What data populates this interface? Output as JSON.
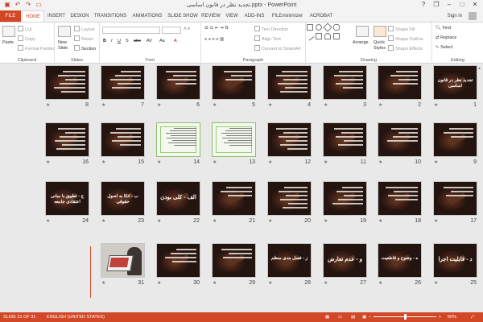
{
  "window": {
    "title": "تجدید نظر در قانون اساسی.pptx - PowerPoint"
  },
  "qat": {
    "save_icon": "save-icon",
    "undo_icon": "undo-icon",
    "redo_icon": "redo-icon",
    "present_icon": "present-icon"
  },
  "window_controls": {
    "help": "?",
    "restore": "❐",
    "minimize": "–",
    "maximize": "□",
    "close": "✕"
  },
  "tabs": [
    {
      "label": "FILE"
    },
    {
      "label": "HOME"
    },
    {
      "label": "INSERT"
    },
    {
      "label": "DESIGN"
    },
    {
      "label": "TRANSITIONS"
    },
    {
      "label": "ANIMATIONS"
    },
    {
      "label": "SLIDE SHOW"
    },
    {
      "label": "REVIEW"
    },
    {
      "label": "VIEW"
    },
    {
      "label": "ADD-INS"
    },
    {
      "label": "FILEminimizer"
    },
    {
      "label": "ACROBAT"
    }
  ],
  "account": {
    "signin": "Sign in"
  },
  "ribbon": {
    "clipboard": {
      "label": "Clipboard",
      "paste": "Paste",
      "cut": "Cut",
      "copy": "Copy",
      "format_painter": "Format Painter"
    },
    "slides": {
      "label": "Slides",
      "new_slide": "New",
      "new_slide2": "Slide",
      "layout": "Layout",
      "reset": "Reset",
      "section": "Section"
    },
    "font": {
      "label": "Font"
    },
    "paragraph": {
      "label": "Paragraph",
      "text_direction": "Text Direction",
      "align_text": "Align Text",
      "convert": "Convert to SmartArt"
    },
    "drawing": {
      "label": "Drawing",
      "arrange": "Arrange",
      "quick_styles": "Quick",
      "quick_styles2": "Styles",
      "shape_fill": "Shape Fill",
      "shape_outline": "Shape Outline",
      "shape_effects": "Shape Effects"
    },
    "editing": {
      "label": "Editing",
      "find": "Find",
      "replace": "Replace",
      "select": "Select"
    }
  },
  "slides": [
    {
      "num": "1",
      "title": "تجدید نظر در قانون اساسی",
      "kind": "title"
    },
    {
      "num": "2",
      "title": "",
      "kind": "text"
    },
    {
      "num": "3",
      "title": "",
      "kind": "text"
    },
    {
      "num": "4",
      "title": "",
      "kind": "text"
    },
    {
      "num": "5",
      "title": "",
      "kind": "text"
    },
    {
      "num": "6",
      "title": "",
      "kind": "text"
    },
    {
      "num": "7",
      "title": "",
      "kind": "text"
    },
    {
      "num": "8",
      "title": "",
      "kind": "text"
    },
    {
      "num": "9",
      "title": "",
      "kind": "text"
    },
    {
      "num": "10",
      "title": "",
      "kind": "text"
    },
    {
      "num": "11",
      "title": "",
      "kind": "text"
    },
    {
      "num": "12",
      "title": "",
      "kind": "text"
    },
    {
      "num": "13",
      "title": "",
      "kind": "doc"
    },
    {
      "num": "14",
      "title": "",
      "kind": "doc"
    },
    {
      "num": "15",
      "title": "",
      "kind": "text"
    },
    {
      "num": "16",
      "title": "",
      "kind": "text"
    },
    {
      "num": "17",
      "title": "",
      "kind": "text"
    },
    {
      "num": "18",
      "title": "",
      "kind": "text"
    },
    {
      "num": "19",
      "title": "",
      "kind": "text"
    },
    {
      "num": "20",
      "title": "",
      "kind": "text"
    },
    {
      "num": "21",
      "title": "",
      "kind": "text"
    },
    {
      "num": "22",
      "title": "الف - کلی بودن",
      "kind": "title"
    },
    {
      "num": "23",
      "title": "ب - اتکا به اصول حقوقی",
      "kind": "title"
    },
    {
      "num": "24",
      "title": "ج - تطبیق با مبانی اعتقادی جامعه",
      "kind": "title"
    },
    {
      "num": "25",
      "title": "د - قابلیت اجرا",
      "kind": "title"
    },
    {
      "num": "26",
      "title": "ه - وضوح و قاطعیت",
      "kind": "title"
    },
    {
      "num": "27",
      "title": "و - عدم تعارض",
      "kind": "title"
    },
    {
      "num": "28",
      "title": "ز - فصل بندی منظم",
      "kind": "title"
    },
    {
      "num": "29",
      "title": "",
      "kind": "text"
    },
    {
      "num": "30",
      "title": "",
      "kind": "text"
    },
    {
      "num": "31",
      "title": "",
      "kind": "photo"
    }
  ],
  "statusbar": {
    "slide_info": "SLIDE 31 OF 31",
    "language": "ENGLISH (UNITED STATES)",
    "zoom_minus": "–",
    "zoom_plus": "+",
    "zoom": "50%",
    "zoom_level_percent": 50
  },
  "colors": {
    "accent": "#d24726",
    "slide_bg": "#241410"
  }
}
